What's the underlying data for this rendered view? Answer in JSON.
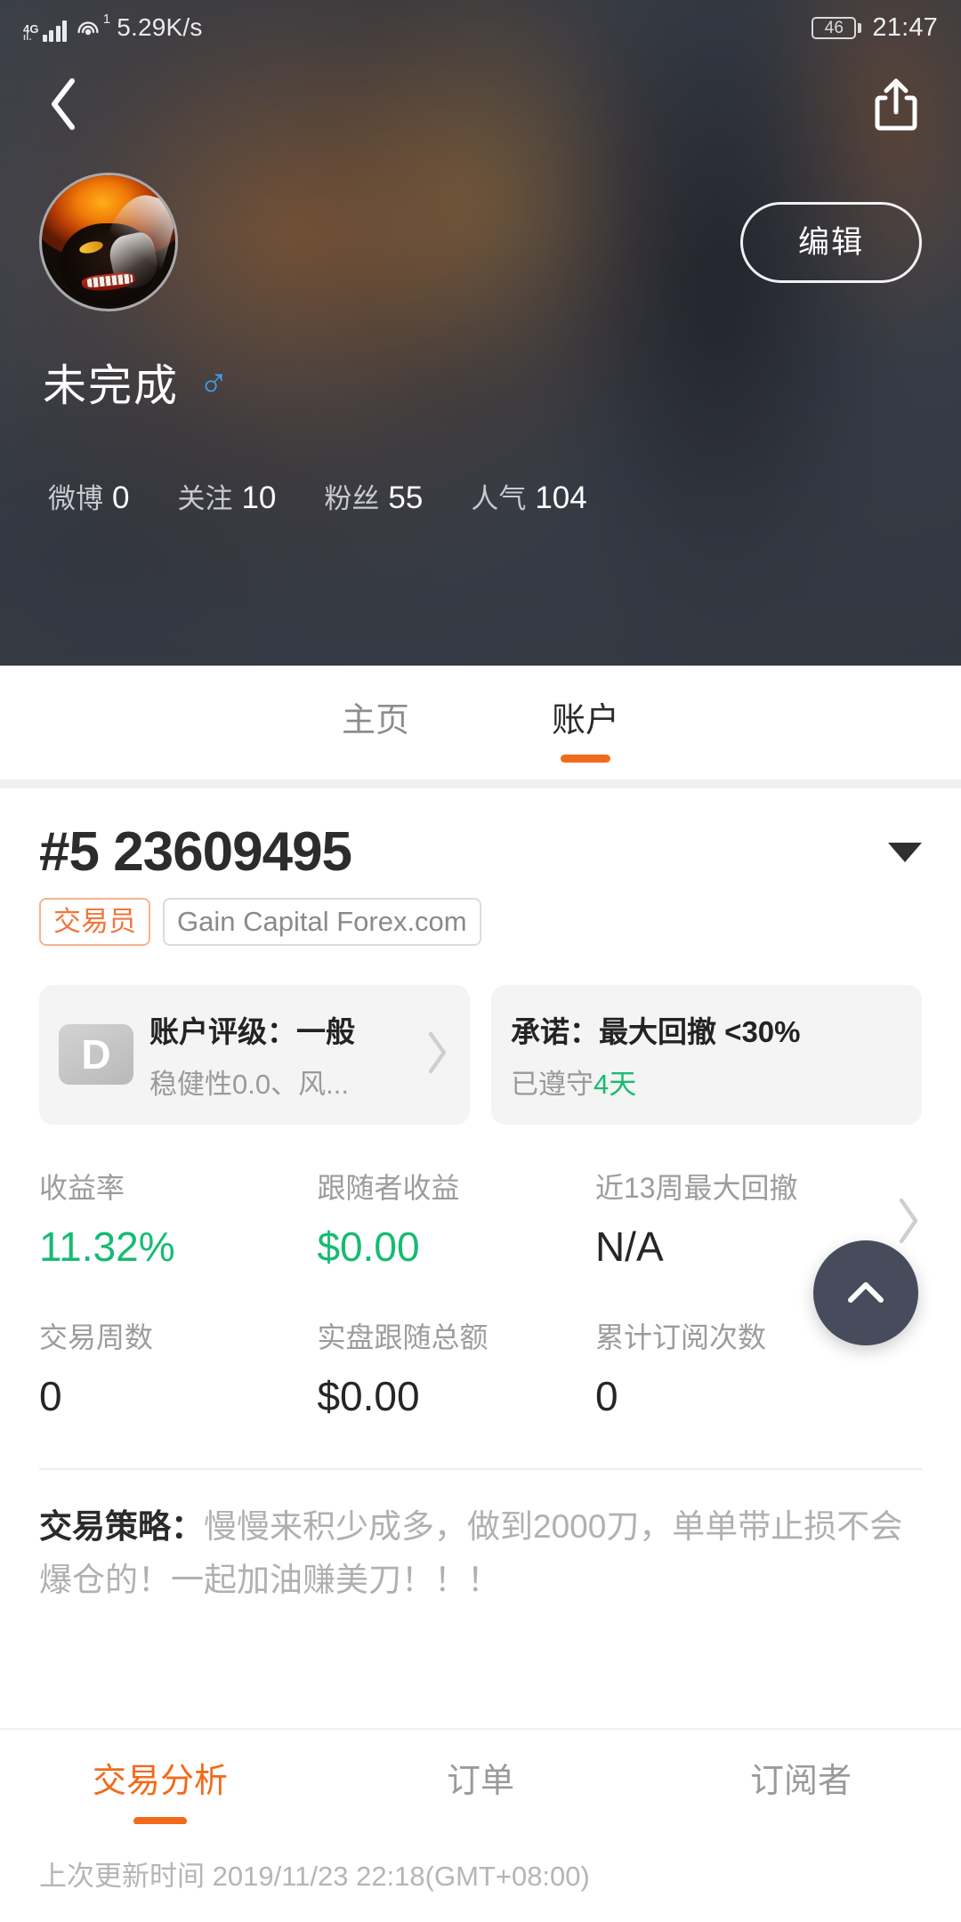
{
  "statusbar": {
    "network_type": "4G",
    "hotspot_count": "1",
    "speed": "5.29K/s",
    "battery": "46",
    "time": "21:47"
  },
  "nav": {
    "back_icon": "chevron-left-icon",
    "share_icon": "share-icon"
  },
  "profile": {
    "edit_label": "编辑",
    "username": "未完成",
    "gender_symbol": "♂",
    "stats": [
      {
        "label": "微博",
        "value": "0"
      },
      {
        "label": "关注",
        "value": "10"
      },
      {
        "label": "粉丝",
        "value": "55"
      },
      {
        "label": "人气",
        "value": "104"
      }
    ]
  },
  "top_tabs": [
    {
      "label": "主页",
      "active": false
    },
    {
      "label": "账户",
      "active": true
    }
  ],
  "account": {
    "id": "#5 23609495",
    "trader_badge": "交易员",
    "broker_badge": "Gain Capital Forex.com",
    "rating_card": {
      "grade": "D",
      "title": "账户评级：一般",
      "subtitle": "稳健性0.0、风..."
    },
    "promise_card": {
      "title": "承诺：最大回撤 <30%",
      "sub_prefix": "已遵守",
      "sub_highlight": "4天"
    },
    "metrics_row1": [
      {
        "label": "收益率",
        "value": "11.32%",
        "color": "green"
      },
      {
        "label": "跟随者收益",
        "value": "$0.00",
        "color": "green"
      },
      {
        "label": "近13周最大回撤",
        "value": "N/A",
        "color": "dark"
      }
    ],
    "metrics_row2": [
      {
        "label": "交易周数",
        "value": "0",
        "color": "dark"
      },
      {
        "label": "实盘跟随总额",
        "value": "$0.00",
        "color": "dark"
      },
      {
        "label": "累计订阅次数",
        "value": "0",
        "color": "dark"
      }
    ],
    "strategy_label": "交易策略：",
    "strategy_text": "慢慢来积少成多，做到2000刀，单单带止损不会爆仓的！一起加油赚美刀！！！"
  },
  "bottom_tabs": [
    {
      "label": "交易分析",
      "active": true
    },
    {
      "label": "订单",
      "active": false
    },
    {
      "label": "订阅者",
      "active": false
    }
  ],
  "footer": {
    "updated_text": "上次更新时间 2019/11/23 22:18(GMT+08:00)"
  },
  "fab": {
    "icon": "chevron-up-icon"
  },
  "colors": {
    "accent": "#f26a1b",
    "positive": "#17bb72",
    "badge_border": "#f9b38c"
  }
}
